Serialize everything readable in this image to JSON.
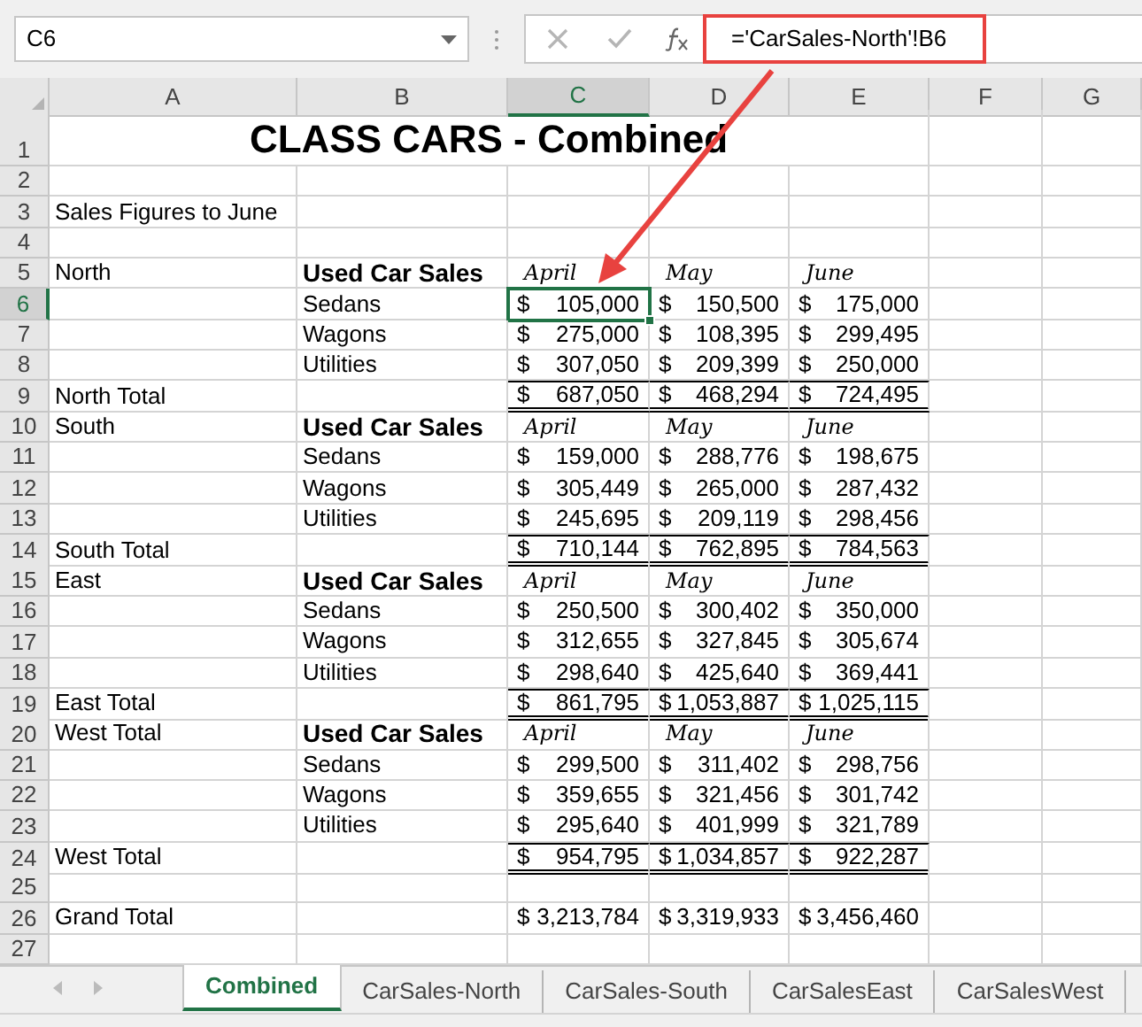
{
  "name_box": "C6",
  "formula": "='CarSales-North'!B6",
  "columns": [
    {
      "label": "A",
      "selected": false
    },
    {
      "label": "B",
      "selected": false
    },
    {
      "label": "C",
      "selected": true
    },
    {
      "label": "D",
      "selected": false
    },
    {
      "label": "E",
      "selected": false
    },
    {
      "label": "F",
      "selected": false
    },
    {
      "label": "G",
      "selected": false
    }
  ],
  "rows": [
    {
      "number": "1",
      "selected": false,
      "kind": "title",
      "a": "CLASS CARS - Combined"
    },
    {
      "number": "2",
      "selected": false,
      "kind": "blank"
    },
    {
      "number": "3",
      "selected": false,
      "kind": "text",
      "a": "Sales Figures to June"
    },
    {
      "number": "4",
      "selected": false,
      "kind": "blank"
    },
    {
      "number": "5",
      "selected": false,
      "kind": "section",
      "a": "North",
      "b": "Used Car Sales",
      "months": [
        "April",
        "May",
        "June"
      ]
    },
    {
      "number": "6",
      "selected": true,
      "kind": "item",
      "b": "Sedans",
      "amounts": [
        {
          "currency": "$",
          "amount": "105,000"
        },
        {
          "currency": "$",
          "amount": "150,500"
        },
        {
          "currency": "$",
          "amount": "175,000"
        }
      ]
    },
    {
      "number": "7",
      "selected": false,
      "kind": "item",
      "b": "Wagons",
      "amounts": [
        {
          "currency": "$",
          "amount": "275,000"
        },
        {
          "currency": "$",
          "amount": "108,395"
        },
        {
          "currency": "$",
          "amount": "299,495"
        }
      ]
    },
    {
      "number": "8",
      "selected": false,
      "kind": "item",
      "b": "Utilities",
      "amounts": [
        {
          "currency": "$",
          "amount": "307,050"
        },
        {
          "currency": "$",
          "amount": "209,399"
        },
        {
          "currency": "$",
          "amount": "250,000"
        }
      ]
    },
    {
      "number": "9",
      "selected": false,
      "kind": "total",
      "a": "North Total",
      "amounts": [
        {
          "currency": "$",
          "amount": "687,050"
        },
        {
          "currency": "$",
          "amount": "468,294"
        },
        {
          "currency": "$",
          "amount": "724,495"
        }
      ]
    },
    {
      "number": "10",
      "selected": false,
      "kind": "section",
      "a": "South",
      "b": "Used Car Sales",
      "months": [
        "April",
        "May",
        "June"
      ]
    },
    {
      "number": "11",
      "selected": false,
      "kind": "item",
      "b": "Sedans",
      "amounts": [
        {
          "currency": "$",
          "amount": "159,000"
        },
        {
          "currency": "$",
          "amount": "288,776"
        },
        {
          "currency": "$",
          "amount": "198,675"
        }
      ]
    },
    {
      "number": "12",
      "selected": false,
      "kind": "item",
      "b": "Wagons",
      "amounts": [
        {
          "currency": "$",
          "amount": "305,449"
        },
        {
          "currency": "$",
          "amount": "265,000"
        },
        {
          "currency": "$",
          "amount": "287,432"
        }
      ]
    },
    {
      "number": "13",
      "selected": false,
      "kind": "item",
      "b": "Utilities",
      "amounts": [
        {
          "currency": "$",
          "amount": "245,695"
        },
        {
          "currency": "$",
          "amount": "209,119"
        },
        {
          "currency": "$",
          "amount": "298,456"
        }
      ]
    },
    {
      "number": "14",
      "selected": false,
      "kind": "total",
      "a": "South Total",
      "amounts": [
        {
          "currency": "$",
          "amount": "710,144"
        },
        {
          "currency": "$",
          "amount": "762,895"
        },
        {
          "currency": "$",
          "amount": "784,563"
        }
      ]
    },
    {
      "number": "15",
      "selected": false,
      "kind": "section",
      "a": "East",
      "b": "Used Car Sales",
      "months": [
        "April",
        "May",
        "June"
      ]
    },
    {
      "number": "16",
      "selected": false,
      "kind": "item",
      "b": "Sedans",
      "amounts": [
        {
          "currency": "$",
          "amount": "250,500"
        },
        {
          "currency": "$",
          "amount": "300,402"
        },
        {
          "currency": "$",
          "amount": "350,000"
        }
      ]
    },
    {
      "number": "17",
      "selected": false,
      "kind": "item",
      "b": "Wagons",
      "amounts": [
        {
          "currency": "$",
          "amount": "312,655"
        },
        {
          "currency": "$",
          "amount": "327,845"
        },
        {
          "currency": "$",
          "amount": "305,674"
        }
      ]
    },
    {
      "number": "18",
      "selected": false,
      "kind": "item",
      "b": "Utilities",
      "amounts": [
        {
          "currency": "$",
          "amount": "298,640"
        },
        {
          "currency": "$",
          "amount": "425,640"
        },
        {
          "currency": "$",
          "amount": "369,441"
        }
      ]
    },
    {
      "number": "19",
      "selected": false,
      "kind": "total",
      "a": "East Total",
      "amounts": [
        {
          "currency": "$",
          "amount": "861,795"
        },
        {
          "currency": "$",
          "amount": "1,053,887"
        },
        {
          "currency": "$",
          "amount": "1,025,115"
        }
      ]
    },
    {
      "number": "20",
      "selected": false,
      "kind": "section",
      "a": "West Total",
      "b": "Used Car Sales",
      "months": [
        "April",
        "May",
        "June"
      ]
    },
    {
      "number": "21",
      "selected": false,
      "kind": "item",
      "b": "Sedans",
      "amounts": [
        {
          "currency": "$",
          "amount": "299,500"
        },
        {
          "currency": "$",
          "amount": "311,402"
        },
        {
          "currency": "$",
          "amount": "298,756"
        }
      ]
    },
    {
      "number": "22",
      "selected": false,
      "kind": "item",
      "b": "Wagons",
      "amounts": [
        {
          "currency": "$",
          "amount": "359,655"
        },
        {
          "currency": "$",
          "amount": "321,456"
        },
        {
          "currency": "$",
          "amount": "301,742"
        }
      ]
    },
    {
      "number": "23",
      "selected": false,
      "kind": "item",
      "b": "Utilities",
      "amounts": [
        {
          "currency": "$",
          "amount": "295,640"
        },
        {
          "currency": "$",
          "amount": "401,999"
        },
        {
          "currency": "$",
          "amount": "321,789"
        }
      ]
    },
    {
      "number": "24",
      "selected": false,
      "kind": "total",
      "a": "West Total",
      "amounts": [
        {
          "currency": "$",
          "amount": "954,795"
        },
        {
          "currency": "$",
          "amount": "1,034,857"
        },
        {
          "currency": "$",
          "amount": "922,287"
        }
      ]
    },
    {
      "number": "25",
      "selected": false,
      "kind": "blank"
    },
    {
      "number": "26",
      "selected": false,
      "kind": "grand",
      "a": "Grand Total",
      "amounts": [
        {
          "currency": "$",
          "amount": "3,213,784"
        },
        {
          "currency": "$",
          "amount": "3,319,933"
        },
        {
          "currency": "$",
          "amount": "3,456,460"
        }
      ]
    },
    {
      "number": "27",
      "selected": false,
      "kind": "blank"
    }
  ],
  "sheet_tabs": [
    {
      "label": "Combined",
      "selected": true
    },
    {
      "label": "CarSales-North",
      "selected": false
    },
    {
      "label": "CarSales-South",
      "selected": false
    },
    {
      "label": "CarSalesEast",
      "selected": false
    },
    {
      "label": "CarSalesWest",
      "selected": false
    }
  ]
}
